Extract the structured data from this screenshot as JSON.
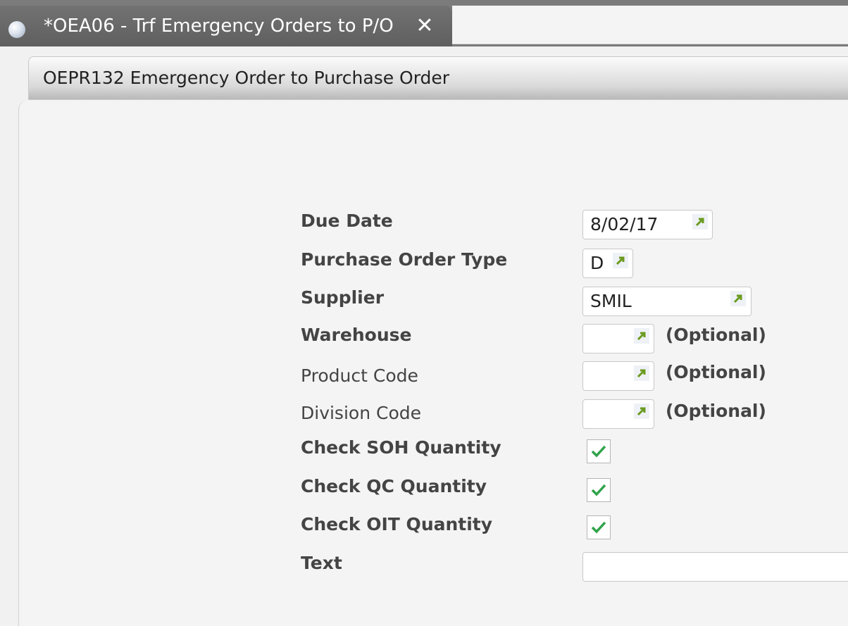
{
  "tab": {
    "title": "*OEA06 - Trf Emergency Orders to P/O",
    "close_symbol": "✕"
  },
  "panel": {
    "title": "OEPR132 Emergency Order to Purchase Order"
  },
  "form": {
    "due_date": {
      "label": "Due Date",
      "value": "8/02/17"
    },
    "po_type": {
      "label": "Purchase Order Type",
      "value": "D"
    },
    "supplier": {
      "label": "Supplier",
      "value": "SMIL"
    },
    "warehouse": {
      "label": "Warehouse",
      "value": "",
      "hint": "(Optional)"
    },
    "product_code": {
      "label": "Product Code",
      "value": "",
      "hint": "(Optional)"
    },
    "division_code": {
      "label": "Division Code",
      "value": "",
      "hint": "(Optional)"
    },
    "check_soh": {
      "label": "Check SOH Quantity",
      "checked": true
    },
    "check_qc": {
      "label": "Check QC Quantity",
      "checked": true
    },
    "check_oit": {
      "label": "Check OIT Quantity",
      "checked": true
    },
    "text": {
      "label": "Text",
      "value": ""
    }
  },
  "colors": {
    "tab_bg": "#6b6b6b",
    "lookup_arrow": "#6a9a1f",
    "check_mark": "#2fa34a"
  },
  "icons": {
    "tab": "globe-icon",
    "lookup": "lookup-arrow-icon",
    "check": "checkmark-icon"
  }
}
